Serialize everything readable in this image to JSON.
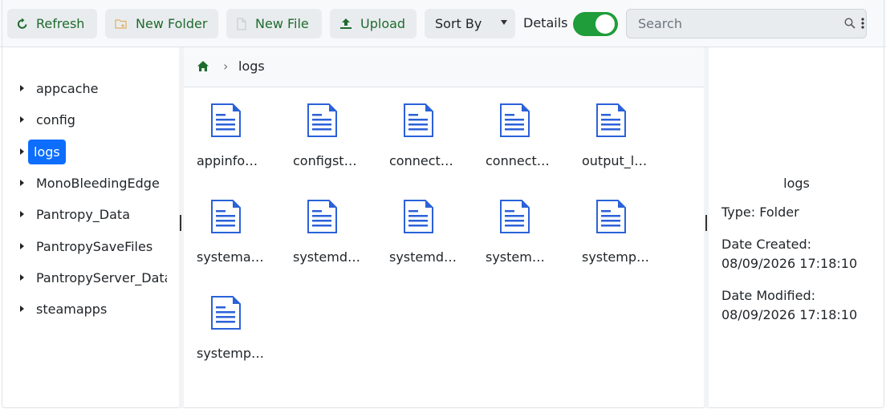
{
  "toolbar": {
    "refresh_label": "Refresh",
    "new_folder_label": "New Folder",
    "new_file_label": "New File",
    "upload_label": "Upload",
    "sort_label": "Sort By",
    "details_label": "Details",
    "details_toggle_on": true,
    "search_placeholder": "Search",
    "accent_color": "#1f9d3a"
  },
  "sidebar": {
    "items": [
      {
        "label": "appcache",
        "selected": false
      },
      {
        "label": "config",
        "selected": false
      },
      {
        "label": "logs",
        "selected": true
      },
      {
        "label": "MonoBleedingEdge",
        "selected": false
      },
      {
        "label": "Pantropy_Data",
        "selected": false
      },
      {
        "label": "PantropySaveFiles",
        "selected": false
      },
      {
        "label": "PantropyServer_Data",
        "selected": false
      },
      {
        "label": "steamapps",
        "selected": false
      }
    ],
    "selected_color": "#0d6efd"
  },
  "breadcrumb": {
    "home_icon": "home-icon",
    "current": "logs"
  },
  "files": [
    {
      "name": "appinfo_…",
      "icon": "document-icon"
    },
    {
      "name": "configst…",
      "icon": "document-icon"
    },
    {
      "name": "connecti…",
      "icon": "document-icon"
    },
    {
      "name": "connecti…",
      "icon": "document-icon"
    },
    {
      "name": "output_l…",
      "icon": "document-icon"
    },
    {
      "name": "systema…",
      "icon": "document-icon"
    },
    {
      "name": "systemd…",
      "icon": "document-icon"
    },
    {
      "name": "systemd…",
      "icon": "document-icon"
    },
    {
      "name": "system…",
      "icon": "document-icon"
    },
    {
      "name": "systemp…",
      "icon": "document-icon"
    },
    {
      "name": "systemp…",
      "icon": "document-icon"
    }
  ],
  "details": {
    "title": "logs",
    "type": "Type: Folder",
    "created_label": "Date Created:",
    "created_value": "08/09/2026 17:18:10",
    "modified_label": "Date Modified:",
    "modified_value": "08/09/2026 17:18:10"
  }
}
